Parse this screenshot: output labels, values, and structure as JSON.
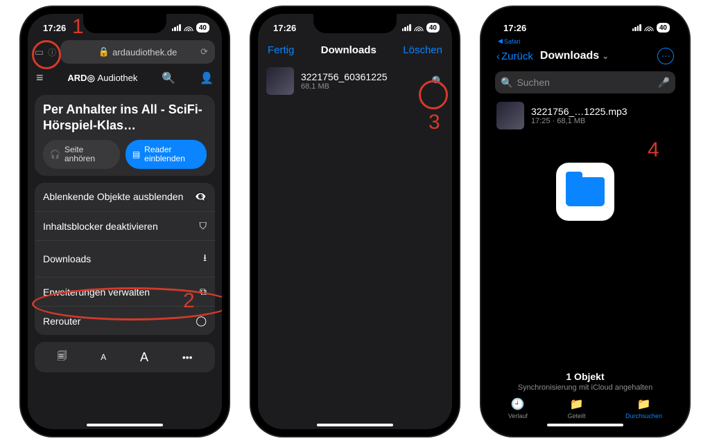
{
  "annotations": {
    "n1": "1",
    "n2": "2",
    "n3": "3",
    "n4": "4"
  },
  "common": {
    "time": "17:26",
    "battery": "40"
  },
  "screen1": {
    "url": "ardaudiothek.de",
    "brand": "ARD",
    "brand2": "Audiothek",
    "panel_title": "Per Anhalter ins All - SciFi-Hörspiel-Klas…",
    "btn_listen": "Seite anhören",
    "btn_reader": "Reader einblenden",
    "menu": {
      "hide_distractions": "Ablenkende Objekte ausblenden",
      "disable_blockers": "Inhaltsblocker deaktivieren",
      "downloads": "Downloads",
      "extensions": "Erweiterungen verwalten",
      "rerouter": "Rerouter"
    },
    "tool_small_a": "A",
    "tool_big_a": "A"
  },
  "screen2": {
    "done": "Fertig",
    "title": "Downloads",
    "clear": "Löschen",
    "file_name": "3221756_60361225",
    "file_size": "68,1 MB"
  },
  "screen3": {
    "safari_back": "Safari",
    "back": "Zurück",
    "title": "Downloads",
    "search_placeholder": "Suchen",
    "file_name": "3221756_…1225.mp3",
    "file_meta": "17:25 · 68,1 MB",
    "count": "1 Objekt",
    "sync": "Synchronisierung mit iCloud angehalten",
    "tab_recent": "Verlauf",
    "tab_shared": "Geteilt",
    "tab_browse": "Durchsuchen"
  }
}
